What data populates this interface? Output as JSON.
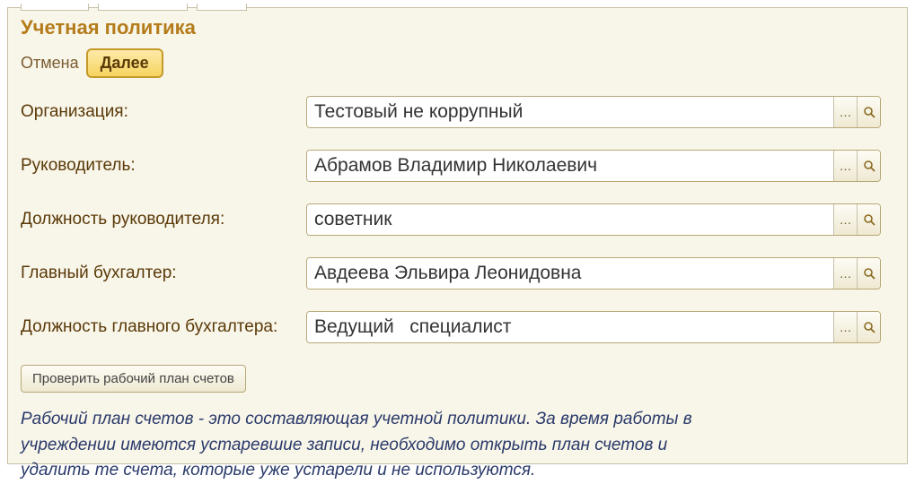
{
  "title": "Учетная политика",
  "actions": {
    "cancel": "Отмена",
    "next": "Далее"
  },
  "fields": {
    "organization": {
      "label": "Организация:",
      "value": "Тестовый не коррупный"
    },
    "manager": {
      "label": "Руководитель:",
      "value": "Абрамов Владимир Николаевич"
    },
    "manager_position": {
      "label": "Должность руководителя:",
      "value": "советник"
    },
    "chief_accountant": {
      "label": "Главный бухгалтер:",
      "value": "Авдеева Эльвира Леонидовна"
    },
    "chief_accountant_position": {
      "label": "Должность главного бухгалтера:",
      "value": "Ведущий   специалист"
    }
  },
  "check_button": "Проверить рабочий план счетов",
  "hint": "Рабочий план счетов - это составляющая учетной политики. За время работы в учреждении имеются устаревшие записи, необходимо открыть план счетов и удалить те счета, которые уже устарели и не используются."
}
